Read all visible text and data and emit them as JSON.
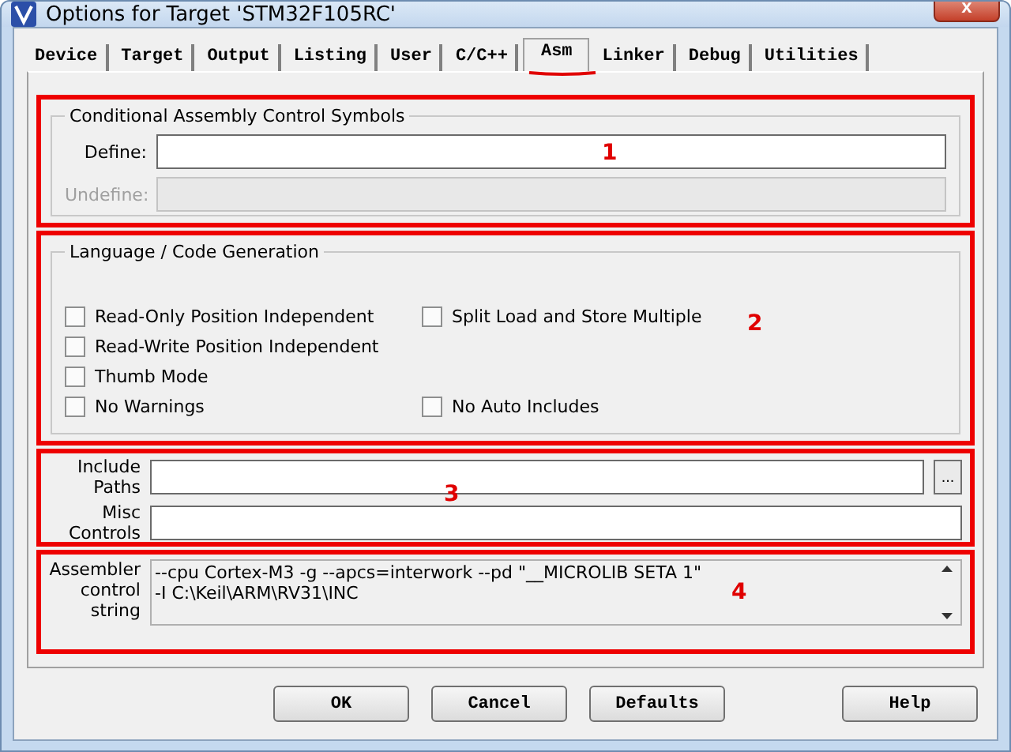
{
  "window": {
    "title": "Options for Target 'STM32F105RC'",
    "close": "x"
  },
  "tabs": [
    {
      "label": "Device",
      "selected": false,
      "underlined": false
    },
    {
      "label": "Target",
      "selected": false,
      "underlined": false
    },
    {
      "label": "Output",
      "selected": false,
      "underlined": false
    },
    {
      "label": "Listing",
      "selected": false,
      "underlined": false
    },
    {
      "label": "User",
      "selected": false,
      "underlined": false
    },
    {
      "label": "C/C++",
      "selected": false,
      "underlined": false
    },
    {
      "label": "Asm",
      "selected": true,
      "underlined": true
    },
    {
      "label": "Linker",
      "selected": false,
      "underlined": false
    },
    {
      "label": "Debug",
      "selected": false,
      "underlined": false
    },
    {
      "label": "Utilities",
      "selected": false,
      "underlined": false
    }
  ],
  "symbols": {
    "marker": "1",
    "title": "Conditional Assembly Control Symbols",
    "fields": [
      {
        "label": "Define:",
        "disabled": false
      },
      {
        "label": "Undefine:",
        "disabled": true
      }
    ]
  },
  "code_generation": {
    "marker": "2",
    "title": "Language / Code Generation",
    "rows": [
      {
        "left": {
          "label": "Read-Only Position Independent",
          "checked": false
        },
        "right": {
          "label": "Split Load and Store Multiple",
          "checked": false
        }
      },
      {
        "left": {
          "label": "Read-Write Position Independent",
          "checked": false
        }
      },
      {
        "left": {
          "label": "Thumb Mode",
          "checked": false
        }
      },
      {
        "left": {
          "label": "No Warnings",
          "checked": false
        },
        "right": {
          "label": "No Auto Includes",
          "checked": false
        }
      }
    ]
  },
  "paths": {
    "marker": "3",
    "include_label": [
      "Include",
      "Paths"
    ],
    "browse": "...",
    "misc_label": [
      "Misc",
      "Controls"
    ]
  },
  "control_string": {
    "marker": "4",
    "label": [
      "Assembler",
      "control",
      "string"
    ],
    "lines": [
      "--cpu Cortex-M3 -g --apcs=interwork --pd \"__MICROLIB SETA 1\"",
      "-I C:\\Keil\\ARM\\RV31\\INC"
    ]
  },
  "buttons": [
    {
      "label": "OK",
      "kind": "action"
    },
    {
      "label": "Cancel",
      "kind": "action"
    },
    {
      "label": "Defaults",
      "kind": "action"
    },
    {
      "label": "Help",
      "kind": "help"
    }
  ]
}
